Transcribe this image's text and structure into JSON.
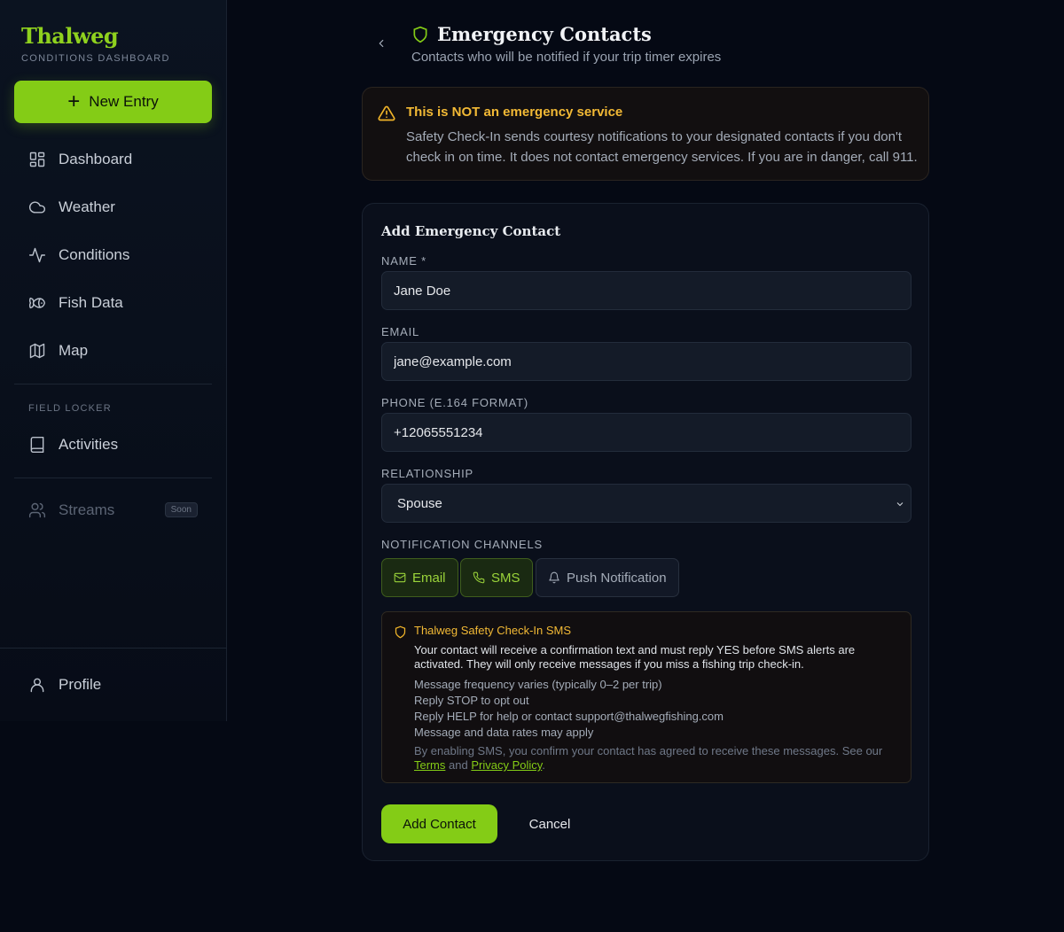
{
  "brand": {
    "name": "Thalweg",
    "subtitle": "CONDITIONS DASHBOARD"
  },
  "sidebar": {
    "new_entry_label": "New Entry",
    "items": [
      {
        "label": "Dashboard",
        "icon": "dashboard-icon"
      },
      {
        "label": "Weather",
        "icon": "cloud-icon"
      },
      {
        "label": "Conditions",
        "icon": "activity-icon"
      },
      {
        "label": "Fish Data",
        "icon": "fish-icon"
      },
      {
        "label": "Map",
        "icon": "map-icon"
      }
    ],
    "section_label": "FIELD LOCKER",
    "locker_items": [
      {
        "label": "Activities",
        "icon": "book-icon"
      },
      {
        "label": "Streams",
        "icon": "users-icon",
        "badge": "Soon",
        "disabled": true
      }
    ],
    "profile_label": "Profile"
  },
  "header": {
    "title": "Emergency Contacts",
    "subtitle": "Contacts who will be notified if your trip timer expires"
  },
  "warning": {
    "title": "This is NOT an emergency service",
    "body": "Safety Check-In sends courtesy notifications to your designated contacts if you don't check in on time. It does not contact emergency services. If you are in danger, call 911."
  },
  "form": {
    "title": "Add Emergency Contact",
    "name_label": "NAME *",
    "name_value": "Jane Doe",
    "email_label": "EMAIL",
    "email_value": "jane@example.com",
    "phone_label": "PHONE (E.164 FORMAT)",
    "phone_value": "+12065551234",
    "relationship_label": "RELATIONSHIP",
    "relationship_value": "Spouse",
    "channels_label": "NOTIFICATION CHANNELS",
    "channels": [
      {
        "label": "Email",
        "selected": true
      },
      {
        "label": "SMS",
        "selected": true
      },
      {
        "label": "Push Notification",
        "selected": false
      }
    ],
    "sms": {
      "title": "Thalweg Safety Check-In SMS",
      "description": "Your contact will receive a confirmation text and must reply YES before SMS alerts are activated. They will only receive messages if you miss a fishing trip check-in.",
      "lines": [
        "Message frequency varies (typically 0–2 per trip)",
        "Reply STOP to opt out",
        "Reply HELP for help or contact support@thalwegfishing.com",
        "Message and data rates may apply"
      ],
      "consent_prefix": "By enabling SMS, you confirm your contact has agreed to receive these messages. See our",
      "terms_label": "Terms",
      "and_label": "and",
      "privacy_label": "Privacy Policy",
      "period": "."
    },
    "submit_label": "Add Contact",
    "cancel_label": "Cancel"
  },
  "colors": {
    "accent": "#84cc16",
    "warning": "#f2b935",
    "background": "#050914"
  }
}
